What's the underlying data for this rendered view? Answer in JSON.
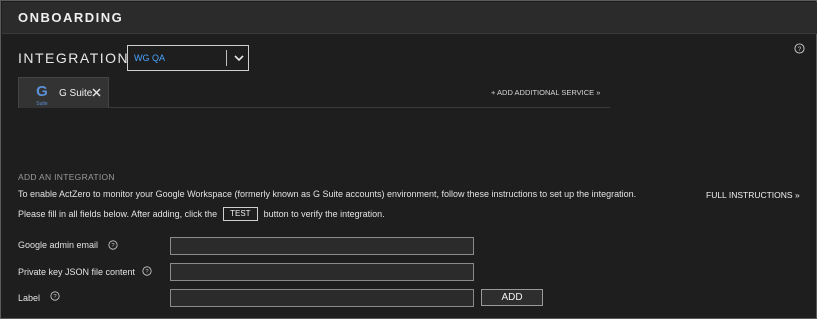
{
  "header": {
    "title": "ONBOARDING"
  },
  "integrations": {
    "label": "INTEGRATIONS",
    "environment_select": {
      "value": "WG QA"
    }
  },
  "tabs": [
    {
      "label": "G Suite",
      "logo_letter": "G",
      "logo_caption": "Suite"
    }
  ],
  "add_service_link": "+ ADD ADDITIONAL SERVICE »",
  "form": {
    "section_heading": "ADD AN INTEGRATION",
    "description_line1": "To enable ActZero to monitor your Google Workspace (formerly known as G Suite accounts) environment, follow these instructions to set up the integration.",
    "full_instructions_link": "FULL INSTRUCTIONS »",
    "description_line2_before": "Please fill in all fields below. After adding, click the",
    "test_chip": "TEST",
    "description_line2_after": "button to verify the integration.",
    "fields": {
      "admin_email": {
        "label": "Google admin email",
        "value": ""
      },
      "private_key": {
        "label": "Private key JSON file content",
        "value": ""
      },
      "label": {
        "label": "Label",
        "value": ""
      }
    },
    "add_button": "ADD"
  },
  "colors": {
    "accent": "#4aa3ff",
    "background": "#1e1e1e",
    "header": "#2b2b2b"
  },
  "icons": [
    "help-circle-icon",
    "chevron-down-icon",
    "g-suite-logo-icon",
    "close-icon"
  ]
}
